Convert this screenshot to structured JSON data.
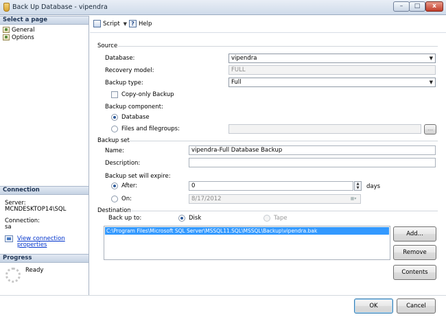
{
  "window": {
    "title": "Back Up Database - vipendra",
    "min": "–",
    "max": "□",
    "close": "x"
  },
  "left": {
    "select_page": "Select a page",
    "pages": [
      {
        "label": "General"
      },
      {
        "label": "Options"
      }
    ],
    "connection_header": "Connection",
    "server_label": "Server:",
    "server_value": "MCNDESKTOP14\\SQL",
    "connection_label": "Connection:",
    "connection_value": "sa",
    "view_props_link": "View connection properties",
    "progress_header": "Progress",
    "progress_status": "Ready"
  },
  "toolbar": {
    "script_label": "Script",
    "help_label": "Help"
  },
  "source": {
    "section_label": "Source",
    "database_label": "Database:",
    "database_value": "vipendra",
    "recovery_label": "Recovery model:",
    "recovery_value": "FULL",
    "backup_type_label": "Backup type:",
    "backup_type_value": "Full",
    "copy_only_label": "Copy-only Backup",
    "copy_only_checked": false,
    "component_label": "Backup component:",
    "component_database_label": "Database",
    "component_files_label": "Files and filegroups:",
    "browse_label": "...",
    "selected_component": "Database"
  },
  "backup_set": {
    "section_label": "Backup set",
    "name_label": "Name:",
    "name_value": "vipendra-Full Database Backup",
    "description_label": "Description:",
    "description_value": "",
    "expire_label": "Backup set will expire:",
    "after_label": "After:",
    "after_value": "0",
    "days_label": "days",
    "on_label": "On:",
    "on_value": "8/17/2012",
    "selected_expire": "After"
  },
  "destination": {
    "section_label": "Destination",
    "backup_to_label": "Back up to:",
    "disk_label": "Disk",
    "tape_label": "Tape",
    "selected_media": "Disk",
    "files": [
      "C:\\Program Files\\Microsoft SQL Server\\MSSQL11.SQL\\MSSQL\\Backup\\vipendra.bak"
    ],
    "add_label": "Add...",
    "remove_label": "Remove",
    "contents_label": "Contents"
  },
  "footer": {
    "ok_label": "OK",
    "cancel_label": "Cancel"
  },
  "icons": {
    "app": "database-icon",
    "page": "page-icon",
    "script": "script-icon",
    "help": "help-icon",
    "props": "properties-icon",
    "spinner": "progress-spinner-icon"
  }
}
